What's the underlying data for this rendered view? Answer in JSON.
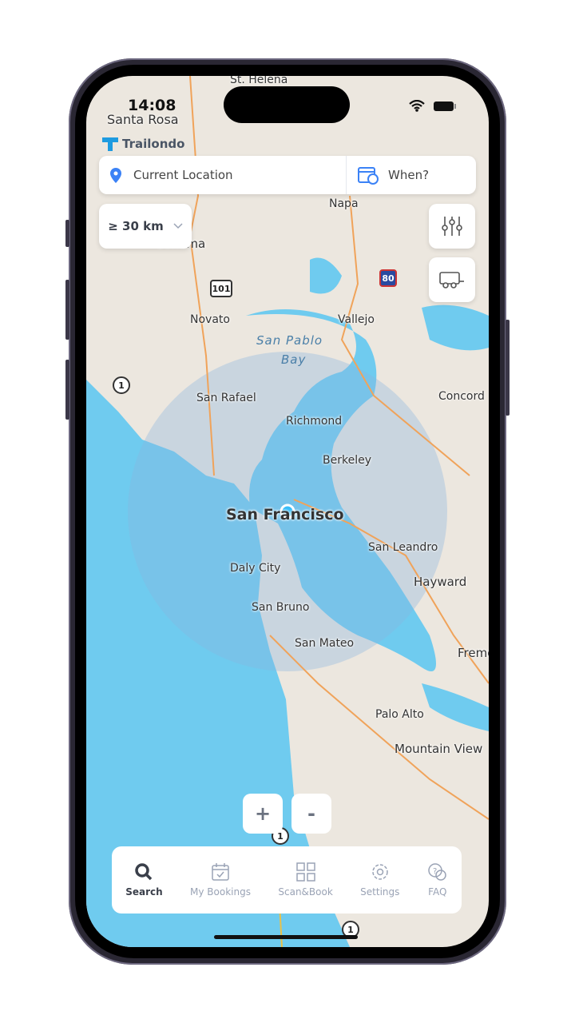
{
  "status_bar": {
    "time": "14:08"
  },
  "app": {
    "brand": "Trailondo",
    "accent": "#3b82f6"
  },
  "search": {
    "location": "Current Location",
    "when": "When?",
    "radius": "≥ 30 km"
  },
  "map": {
    "cities": [
      "St. Helena",
      "Santa Rosa",
      "Napa",
      "Novato",
      "Vallejo",
      "San Rafael",
      "Richmond",
      "Concord",
      "Berkeley",
      "San Francisco",
      "San Leandro",
      "Hayward",
      "Daly City",
      "San Bruno",
      "San Mateo",
      "Fremont",
      "Palo Alto",
      "Mountain View",
      "Sonoma"
    ],
    "bay": [
      "San Pablo",
      "Bay"
    ],
    "highways": [
      "101",
      "80",
      "1",
      "1",
      "1"
    ],
    "water_color": "#6fcbef",
    "land_color": "#ece7df"
  },
  "zoom_controls": {
    "plus": "+",
    "minus": "-"
  },
  "nav": [
    {
      "label": "Search",
      "icon": "search-icon",
      "active": true
    },
    {
      "label": "My Bookings",
      "icon": "calendar-check-icon"
    },
    {
      "label": "Scan&Book",
      "icon": "grid-icon"
    },
    {
      "label": "Settings",
      "icon": "gear-icon"
    },
    {
      "label": "FAQ",
      "icon": "question-chat-icon"
    }
  ]
}
